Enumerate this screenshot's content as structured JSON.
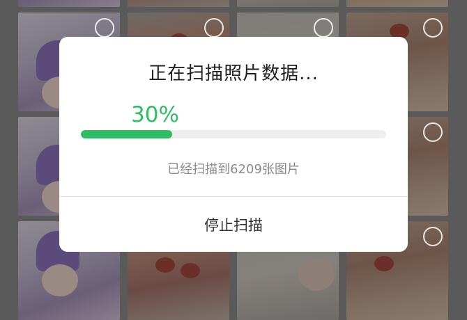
{
  "dialog": {
    "title": "正在扫描照片数据...",
    "progress_text": "30%",
    "progress_fraction": 0.3,
    "status_text": "已经扫描到6209张图片",
    "stop_button_label": "停止扫描"
  },
  "colors": {
    "accent": "#2fbd63",
    "track": "#eeeeee"
  },
  "icons": [
    "select-circle-icon"
  ]
}
